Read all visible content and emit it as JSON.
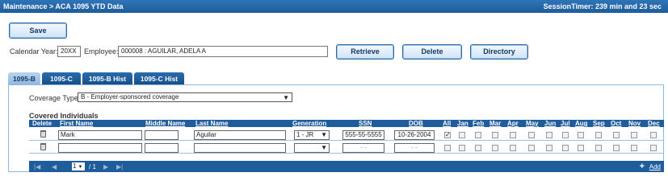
{
  "titlebar": {
    "breadcrumb": "Maintenance > ACA 1095 YTD Data",
    "session_timer": "SessionTimer: 239 min and 23 sec"
  },
  "toolbar": {
    "save_label": "Save"
  },
  "search": {
    "calendar_year_label": "Calendar Year:",
    "calendar_year_value": "20XX",
    "employee_label": "Employee:",
    "employee_value": "000008 : AGUILAR, ADELA A",
    "retrieve_label": "Retrieve",
    "delete_label": "Delete",
    "directory_label": "Directory"
  },
  "tabs": [
    {
      "label": "1095-B",
      "active": true
    },
    {
      "label": "1095-C",
      "active": false
    },
    {
      "label": "1095-B Hist",
      "active": false
    },
    {
      "label": "1095-C Hist",
      "active": false
    }
  ],
  "coverage": {
    "label": "Coverage Type:",
    "value": "B - Employer-sponsored coverage"
  },
  "covered": {
    "title": "Covered Individuals",
    "columns": {
      "delete": "Delete",
      "first": "First Name",
      "middle": "Middle Name",
      "last": "Last Name",
      "generation": "Generation",
      "ssn": "SSN",
      "dob": "DOB",
      "all": "All"
    },
    "months": [
      "Jan",
      "Feb",
      "Mar",
      "Apr",
      "May",
      "Jun",
      "Jul",
      "Aug",
      "Sep",
      "Oct",
      "Nov",
      "Dec"
    ],
    "rows": [
      {
        "first": "Mark",
        "middle": "",
        "last": "Aguilar",
        "generation": "1 - JR",
        "ssn": "555-55-5555",
        "dob": "10-26-2004",
        "all": true
      },
      {
        "first": "",
        "middle": "",
        "last": "",
        "generation": "",
        "ssn": "- -",
        "dob": "- -",
        "all": false
      }
    ]
  },
  "pager": {
    "page": "1",
    "of": "/ 1",
    "add_label": "Add",
    "add_icon": "+"
  },
  "colors": {
    "titlebar": "#2f74b8",
    "grid_header": "#1f5c9c",
    "button_border": "#2c6aa8"
  }
}
